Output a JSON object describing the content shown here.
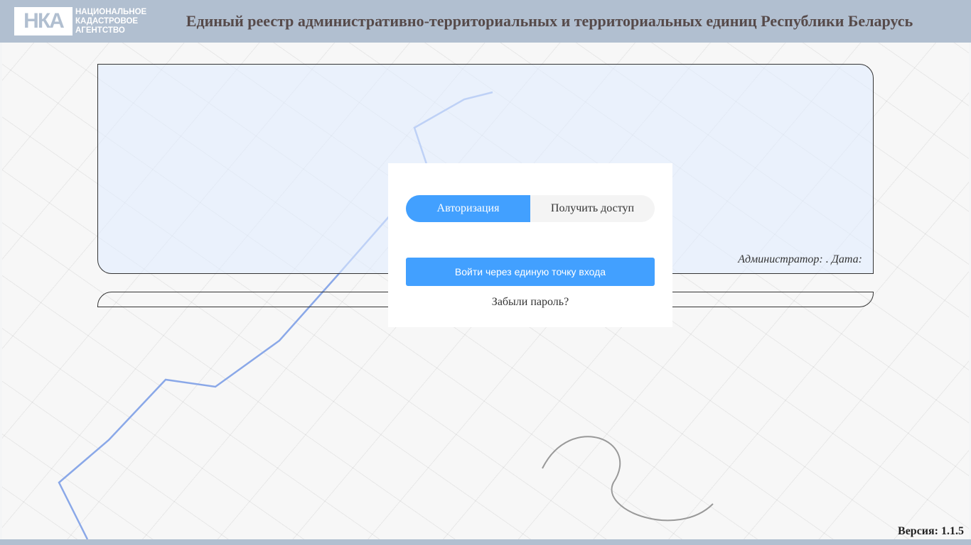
{
  "header": {
    "logo_mark": "НКА",
    "logo_text": "НАЦИОНАЛЬНОЕ КАДАСТРОВОЕ АГЕНТСТВО",
    "title": "Единый реестр административно-территориальных и территориальных единиц Республики Беларусь"
  },
  "info": {
    "admin_line": "Администратор: . Дата:"
  },
  "login": {
    "tabs": [
      "Авторизация",
      "Получить доступ"
    ],
    "sso_button": "Войти через единую точку входа",
    "forgot": "Забыли пароль?"
  },
  "footer": {
    "version": "Версия: 1.1.5"
  }
}
